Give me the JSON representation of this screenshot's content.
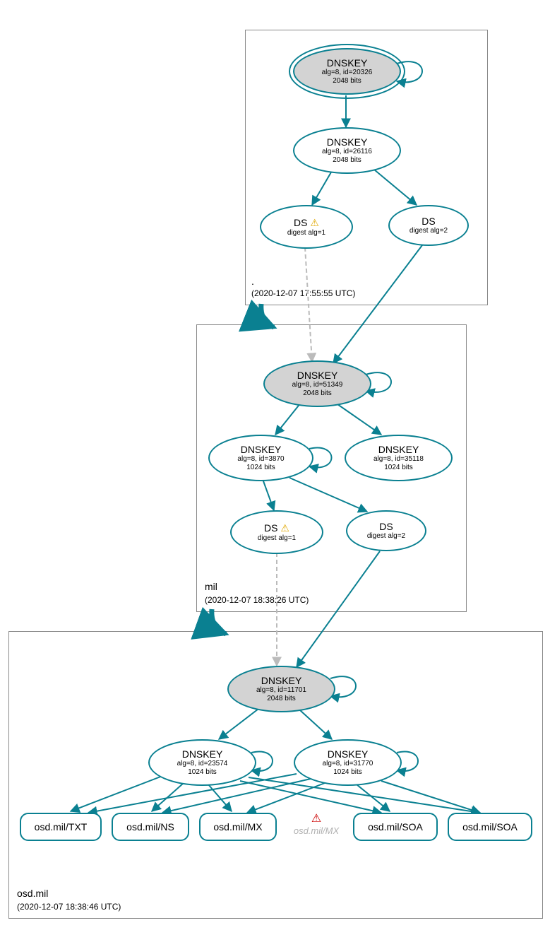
{
  "zones": {
    "root": {
      "label": ".",
      "timestamp": "(2020-12-07 17:55:55 UTC)"
    },
    "mil": {
      "label": "mil",
      "timestamp": "(2020-12-07 18:38:26 UTC)"
    },
    "osdmil": {
      "label": "osd.mil",
      "timestamp": "(2020-12-07 18:38:46 UTC)"
    }
  },
  "nodes": {
    "root_ksk": {
      "title": "DNSKEY",
      "sub1": "alg=8, id=20326",
      "sub2": "2048 bits"
    },
    "root_zsk": {
      "title": "DNSKEY",
      "sub1": "alg=8, id=26116",
      "sub2": "2048 bits"
    },
    "root_ds1": {
      "title": "DS",
      "sub1": "digest alg=1"
    },
    "root_ds2": {
      "title": "DS",
      "sub1": "digest alg=2"
    },
    "mil_ksk": {
      "title": "DNSKEY",
      "sub1": "alg=8, id=51349",
      "sub2": "2048 bits"
    },
    "mil_zsk1": {
      "title": "DNSKEY",
      "sub1": "alg=8, id=3870",
      "sub2": "1024 bits"
    },
    "mil_zsk2": {
      "title": "DNSKEY",
      "sub1": "alg=8, id=35118",
      "sub2": "1024 bits"
    },
    "mil_ds1": {
      "title": "DS",
      "sub1": "digest alg=1"
    },
    "mil_ds2": {
      "title": "DS",
      "sub1": "digest alg=2"
    },
    "osd_ksk": {
      "title": "DNSKEY",
      "sub1": "alg=8, id=11701",
      "sub2": "2048 bits"
    },
    "osd_zsk1": {
      "title": "DNSKEY",
      "sub1": "alg=8, id=23574",
      "sub2": "1024 bits"
    },
    "osd_zsk2": {
      "title": "DNSKEY",
      "sub1": "alg=8, id=31770",
      "sub2": "1024 bits"
    },
    "osd_txt": {
      "title": "osd.mil/TXT"
    },
    "osd_ns": {
      "title": "osd.mil/NS"
    },
    "osd_mx": {
      "title": "osd.mil/MX"
    },
    "osd_mx_err": {
      "title": "osd.mil/MX"
    },
    "osd_soa1": {
      "title": "osd.mil/SOA"
    },
    "osd_soa2": {
      "title": "osd.mil/SOA"
    }
  },
  "icons": {
    "warn": "⚠",
    "warn_tri": "⚠"
  }
}
